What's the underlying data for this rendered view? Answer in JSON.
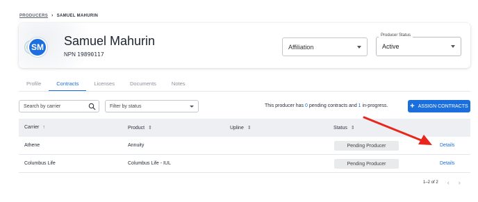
{
  "breadcrumb": {
    "parent": "PRODUCERS",
    "current": "SAMUEL MAHURIN"
  },
  "producer": {
    "initials": "SM",
    "name": "Samuel Mahurin",
    "npn_label": "NPN",
    "npn_value": "19890117"
  },
  "affiliation": {
    "value": "Affiliation"
  },
  "producer_status": {
    "label": "Producer Status",
    "value": "Active"
  },
  "tabs": [
    {
      "label": "Profile",
      "active": false
    },
    {
      "label": "Contracts",
      "active": true
    },
    {
      "label": "Licenses",
      "active": false
    },
    {
      "label": "Documents",
      "active": false
    },
    {
      "label": "Notes",
      "active": false
    }
  ],
  "filters": {
    "search_placeholder": "Search by carrier",
    "status_placeholder": "Filter by status"
  },
  "summary": {
    "prefix": "This producer has ",
    "pending": "0",
    "middle": " pending contracts and ",
    "in_progress": "1",
    "suffix": " in-progress."
  },
  "assign_button": {
    "label": "ASSIGN CONTRACTS"
  },
  "table": {
    "columns": [
      "Carrier",
      "Product",
      "Upline",
      "Status"
    ],
    "rows": [
      {
        "carrier": "Athene",
        "product": "Annuity",
        "upline": "",
        "status": "Pending Producer",
        "action": "Details"
      },
      {
        "carrier": "Columbus Life",
        "product": "Columbus Life - IUL",
        "upline": "",
        "status": "Pending Producer",
        "action": "Details"
      }
    ]
  },
  "pagination": {
    "text": "1–2 of 2"
  },
  "colors": {
    "accent": "#1b6fdc",
    "annotation_arrow": "#e8261e",
    "header_bg": "#edeff2",
    "pill_bg": "#e9eaec"
  }
}
